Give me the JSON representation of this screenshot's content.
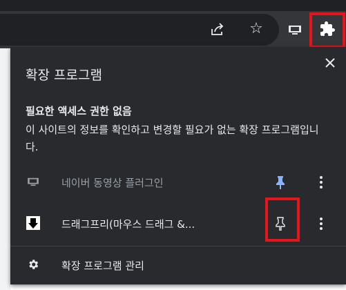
{
  "popup": {
    "title": "확장 프로그램",
    "permission_title": "필요한 액세스 권한 없음",
    "permission_desc": "이 사이트의 정보를 확인하고 변경할 필요가 없는 확장 프로그램입니다.",
    "extensions": [
      {
        "name": "네이버 동영상 플러그인",
        "icon": "naver-video-icon",
        "pinned": true
      },
      {
        "name": "드래그프리(마우스 드래그 &...",
        "icon": "dragfree-icon",
        "pinned": false
      }
    ],
    "manage_label": "확장 프로그램 관리"
  },
  "colors": {
    "toolbar": "#35363a",
    "popup_bg": "#292a2d",
    "text": "#e8eaed",
    "muted_text": "#9aa0a6",
    "pin_active": "#8ab4f8",
    "highlight": "#e8141c"
  }
}
